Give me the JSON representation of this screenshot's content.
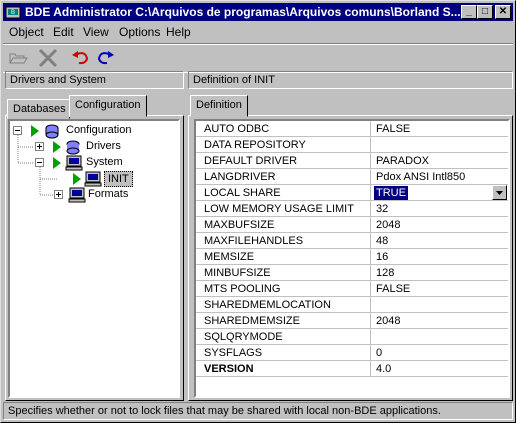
{
  "window": {
    "title": "BDE Administrator  C:\\Arquivos de programas\\Arquivos comuns\\Borland S...",
    "minimize": "_",
    "maximize": "□",
    "close": "✕"
  },
  "menu": [
    {
      "label": "Object"
    },
    {
      "label": "Edit"
    },
    {
      "label": "View"
    },
    {
      "label": "Options"
    },
    {
      "label": "Help"
    }
  ],
  "toolbar": {
    "open_icon": "folder-open-icon",
    "delete_icon": "delete-x-icon",
    "undo_icon": "undo-arrow-icon",
    "redo_icon": "redo-arrow-icon"
  },
  "left_header": "Drivers and System",
  "right_header": "Definition of INIT",
  "left_tabs": [
    {
      "label": "Databases"
    },
    {
      "label": "Configuration"
    }
  ],
  "right_tab": "Definition",
  "tree": [
    {
      "label": "Configuration",
      "expander": "-"
    },
    {
      "label": "Drivers",
      "expander": "+"
    },
    {
      "label": "System",
      "expander": "-"
    },
    {
      "label": "INIT",
      "expander": ""
    },
    {
      "label": "Formats",
      "expander": "+"
    }
  ],
  "definition": [
    {
      "name": "AUTO ODBC",
      "value": "FALSE"
    },
    {
      "name": "DATA REPOSITORY",
      "value": ""
    },
    {
      "name": "DEFAULT DRIVER",
      "value": "PARADOX"
    },
    {
      "name": "LANGDRIVER",
      "value": "Pdox ANSI Intl850"
    },
    {
      "name": "LOCAL SHARE",
      "value": "TRUE"
    },
    {
      "name": "LOW MEMORY USAGE LIMIT",
      "value": "32"
    },
    {
      "name": "MAXBUFSIZE",
      "value": "2048"
    },
    {
      "name": "MAXFILEHANDLES",
      "value": "48"
    },
    {
      "name": "MEMSIZE",
      "value": "16"
    },
    {
      "name": "MINBUFSIZE",
      "value": "128"
    },
    {
      "name": "MTS POOLING",
      "value": "FALSE"
    },
    {
      "name": "SHAREDMEMLOCATION",
      "value": ""
    },
    {
      "name": "SHAREDMEMSIZE",
      "value": "2048"
    },
    {
      "name": "SQLQRYMODE",
      "value": ""
    },
    {
      "name": "SYSFLAGS",
      "value": "0"
    },
    {
      "name": "VERSION",
      "value": "4.0"
    }
  ],
  "status": "Specifies whether or not to lock files that may be shared with local non-BDE applications.",
  "colors": {
    "titlebar": "#000080",
    "selection": "#000080",
    "face": "#c0c0c0"
  }
}
